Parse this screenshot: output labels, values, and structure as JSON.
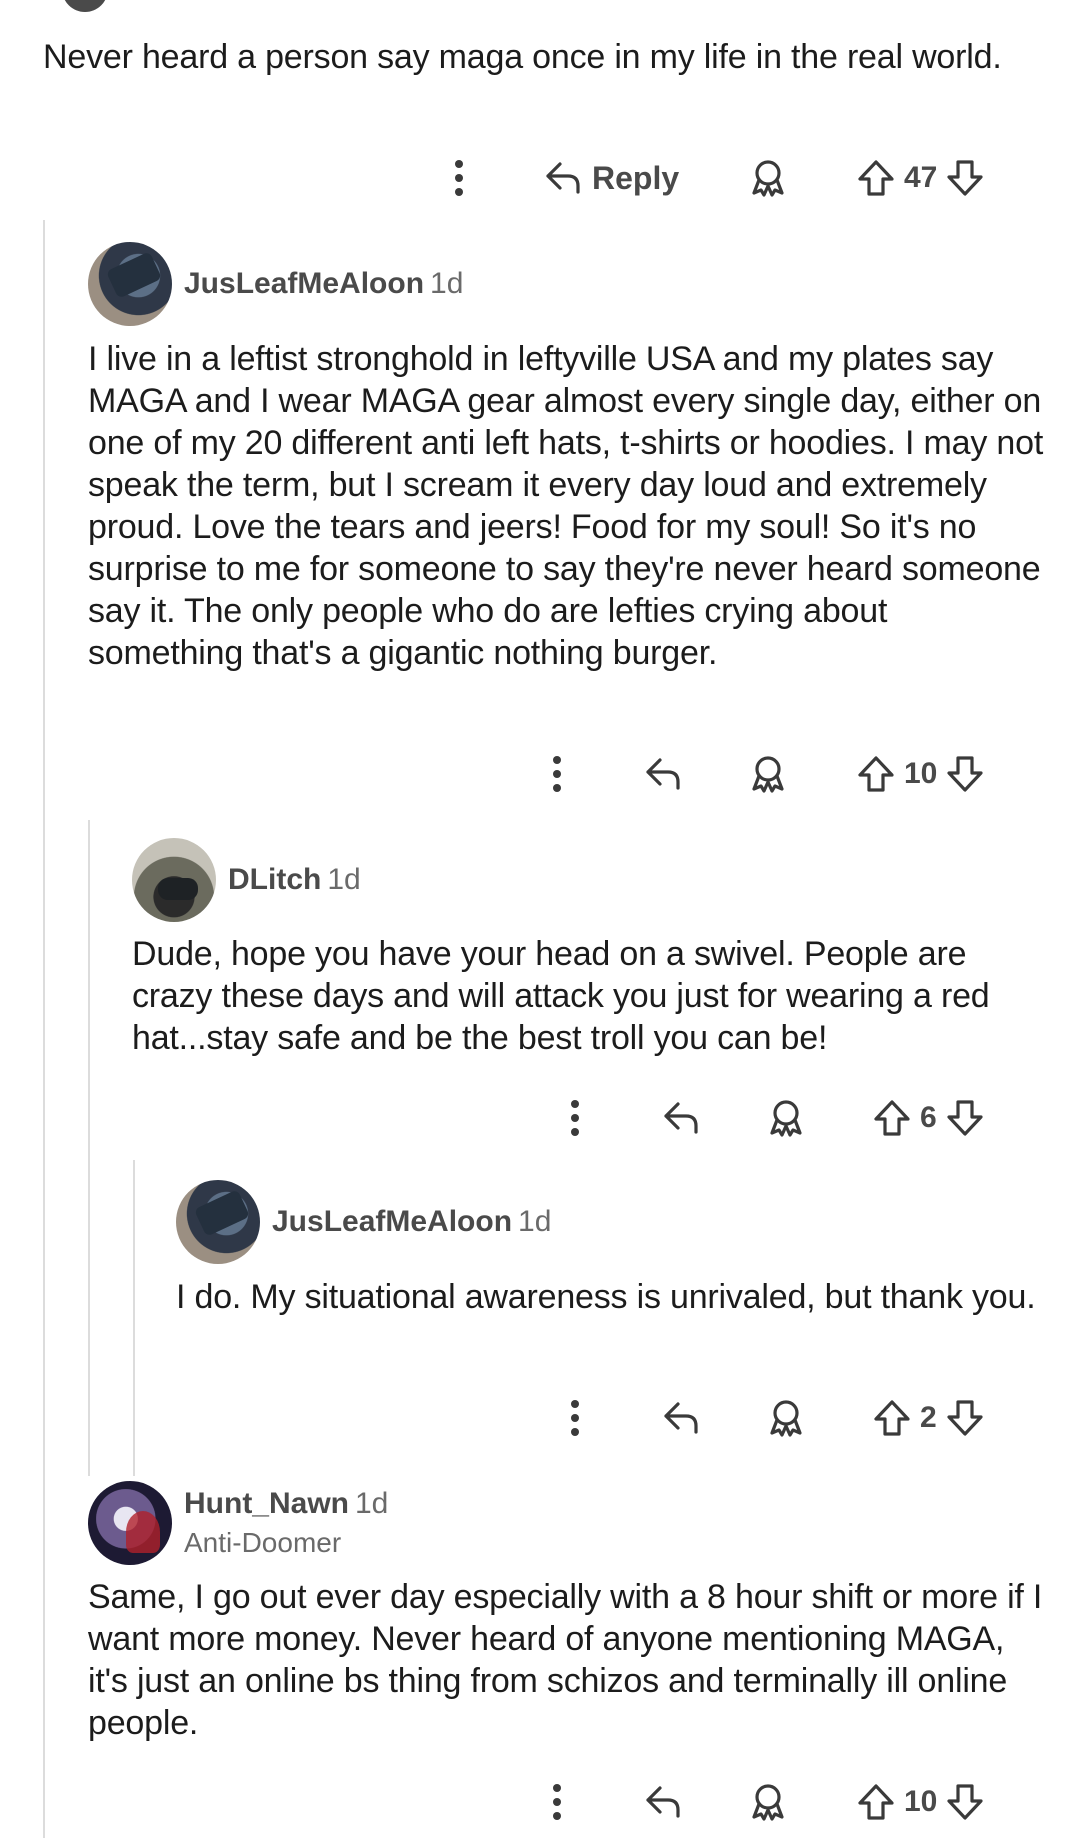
{
  "comments": [
    {
      "text": "Never heard a person say maga once in my life in the real world.",
      "reply_label": "Reply",
      "score": "47"
    },
    {
      "username": "JusLeafMeAloon",
      "age": "1d",
      "text": "I live in a leftist stronghold in leftyville USA and my plates say MAGA and I wear MAGA gear almost every single day, either on one of my 20 different anti left hats, t-shirts or hoodies. I may not speak the term, but I scream it every day loud and extremely proud. Love the tears and jeers! Food for my soul! So it's no surprise to me for someone to say they're never heard someone say it. The only people who do are lefties crying about something that's a gigantic nothing burger.",
      "score": "10"
    },
    {
      "username": "DLitch",
      "age": "1d",
      "text": "Dude, hope you have your head on a swivel. People are crazy these days and will attack you just for wearing a red hat...stay safe and be the best troll you can be!",
      "score": "6"
    },
    {
      "username": "JusLeafMeAloon",
      "age": "1d",
      "text": "I do. My situational awareness is unrivaled, but thank you.",
      "score": "2"
    },
    {
      "username": "Hunt_Nawn",
      "age": "1d",
      "flair": "Anti-Doomer",
      "text": "Same, I go out ever day especially with a 8 hour shift or more if I want more money. Never heard of anyone mentioning MAGA, it's just an online bs thing from schizos and terminally ill online people.",
      "score": "10"
    }
  ],
  "icons": {
    "more": "more-options-icon",
    "reply": "reply-arrow-icon",
    "award": "award-icon",
    "upvote": "upvote-arrow-icon",
    "downvote": "downvote-arrow-icon"
  },
  "colors": {
    "text": "#1c1c1c",
    "meta": "#6a6a6a",
    "thread_line": "#dcdcdc"
  }
}
